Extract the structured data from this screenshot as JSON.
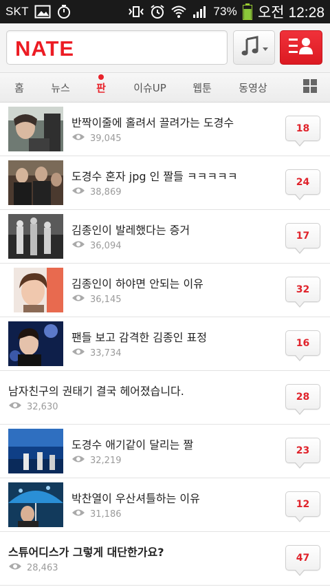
{
  "status_bar": {
    "carrier": "SKT",
    "battery": "73%",
    "time": "오전 12:28",
    "icons": [
      "gallery-icon",
      "timer-icon",
      "vibrate-icon",
      "alarm-icon",
      "wifi-icon",
      "signal-icon",
      "battery-icon"
    ]
  },
  "header": {
    "logo": "NATE",
    "buttons": [
      "music-icon",
      "my-menu-icon"
    ],
    "brand_color": "#ec1c24"
  },
  "tabs": [
    {
      "label": "홈"
    },
    {
      "label": "뉴스"
    },
    {
      "label": "판",
      "active": true
    },
    {
      "label": "이슈UP"
    },
    {
      "label": "웹툰"
    },
    {
      "label": "동영상"
    }
  ],
  "posts": [
    {
      "title": "반짝이줄에 홀려서 끌려가는 도경수",
      "views": "39,045",
      "comments": "18",
      "has_thumb": true
    },
    {
      "title": "도경수 혼자 jpg 인 짤들 ㅋㅋㅋㅋㅋ",
      "views": "38,869",
      "comments": "24",
      "has_thumb": true
    },
    {
      "title": "김종인이 발레했다는 증거",
      "views": "36,094",
      "comments": "17",
      "has_thumb": true
    },
    {
      "title": "김종인이 하야면 안되는 이유",
      "views": "36,145",
      "comments": "32",
      "has_thumb": true
    },
    {
      "title": "팬들 보고 감격한 김종인 표정",
      "views": "33,734",
      "comments": "16",
      "has_thumb": true
    },
    {
      "title": "남자친구의 권태기 결국 헤어졌습니다.",
      "views": "32,630",
      "comments": "28",
      "has_thumb": false
    },
    {
      "title": "도경수 애기같이 달리는 짤",
      "views": "32,219",
      "comments": "23",
      "has_thumb": true
    },
    {
      "title": "박찬열이 우산셔틀하는 이유",
      "views": "31,186",
      "comments": "12",
      "has_thumb": true
    },
    {
      "title": "스튜어디스가 그렇게 대단한가요?",
      "views": "28,463",
      "comments": "47",
      "has_thumb": false,
      "bold": true
    }
  ]
}
